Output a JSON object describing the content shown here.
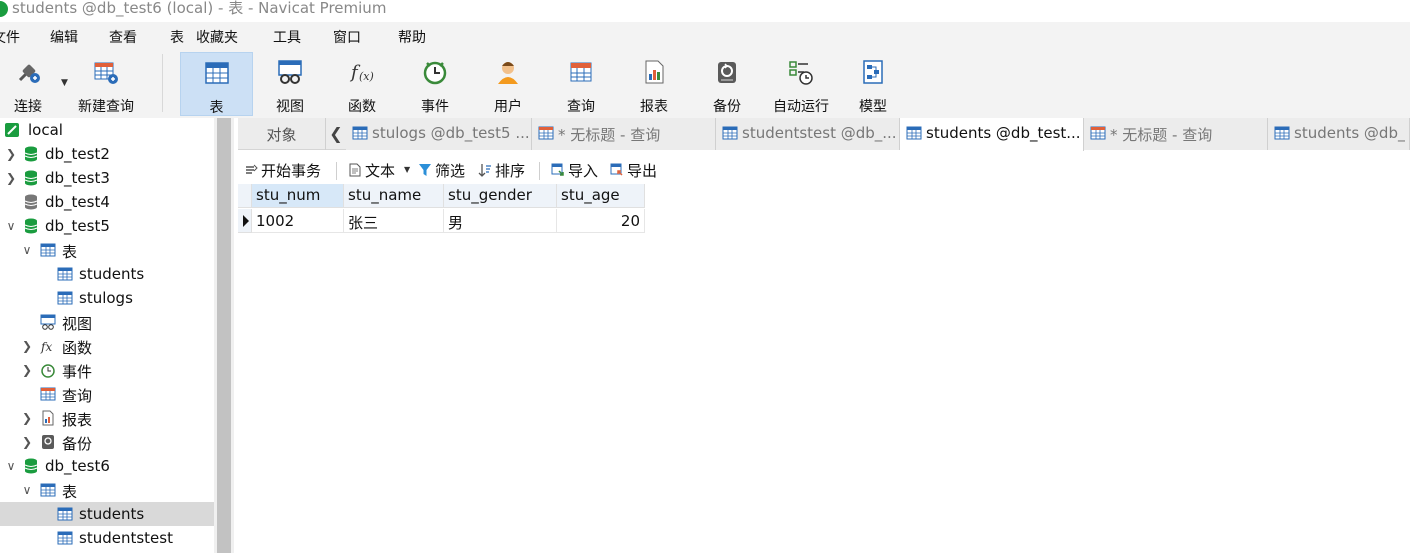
{
  "window": {
    "title": "students @db_test6 (local) - 表 - Navicat Premium"
  },
  "menu": [
    "文件",
    "编辑",
    "查看",
    "表",
    "收藏夹",
    "工具",
    "窗口",
    "帮助"
  ],
  "toolbar": [
    {
      "label": "连接",
      "icon": "plug-icon"
    },
    {
      "label": "新建查询",
      "icon": "new-query-icon"
    },
    {
      "label": "表",
      "icon": "table-icon",
      "active": true
    },
    {
      "label": "视图",
      "icon": "view-icon"
    },
    {
      "label": "函数",
      "icon": "function-icon"
    },
    {
      "label": "事件",
      "icon": "clock-icon"
    },
    {
      "label": "用户",
      "icon": "user-icon"
    },
    {
      "label": "查询",
      "icon": "query-icon"
    },
    {
      "label": "报表",
      "icon": "report-icon"
    },
    {
      "label": "备份",
      "icon": "backup-icon"
    },
    {
      "label": "自动运行",
      "icon": "schedule-icon"
    },
    {
      "label": "模型",
      "icon": "model-icon"
    }
  ],
  "sidebar": {
    "items": [
      {
        "label": "local",
        "icon": "connection-icon",
        "level": 0,
        "chevron": ""
      },
      {
        "label": "db_test2",
        "icon": "database-green-icon",
        "level": 1,
        "chevron": ">"
      },
      {
        "label": "db_test3",
        "icon": "database-green-icon",
        "level": 1,
        "chevron": ">"
      },
      {
        "label": "db_test4",
        "icon": "database-gray-icon",
        "level": 1,
        "chevron": ""
      },
      {
        "label": "db_test5",
        "icon": "database-green-icon",
        "level": 1,
        "chevron": "v"
      },
      {
        "label": "表",
        "icon": "table-icon",
        "level": 2,
        "chevron": "v"
      },
      {
        "label": "students",
        "icon": "table-icon",
        "level": 3,
        "chevron": ""
      },
      {
        "label": "stulogs",
        "icon": "table-icon",
        "level": 3,
        "chevron": ""
      },
      {
        "label": "视图",
        "icon": "view-icon",
        "level": 2,
        "chevron": ""
      },
      {
        "label": "函数",
        "icon": "function-icon",
        "level": 2,
        "chevron": ">"
      },
      {
        "label": "事件",
        "icon": "clock-icon",
        "level": 2,
        "chevron": ">"
      },
      {
        "label": "查询",
        "icon": "query-icon",
        "level": 2,
        "chevron": ""
      },
      {
        "label": "报表",
        "icon": "report-icon",
        "level": 2,
        "chevron": ">"
      },
      {
        "label": "备份",
        "icon": "backup-icon",
        "level": 2,
        "chevron": ">"
      },
      {
        "label": "db_test6",
        "icon": "database-green-icon",
        "level": 1,
        "chevron": "v"
      },
      {
        "label": "表",
        "icon": "table-icon",
        "level": 2,
        "chevron": "v"
      },
      {
        "label": "students",
        "icon": "table-icon",
        "level": 3,
        "chevron": "",
        "selected": true
      },
      {
        "label": "studentstest",
        "icon": "table-icon",
        "level": 3,
        "chevron": ""
      }
    ]
  },
  "tabs": {
    "objects_label": "对象",
    "items": [
      {
        "label": "stulogs @db_test5 ...",
        "icon": "table-icon"
      },
      {
        "label": "* 无标题 - 查询",
        "icon": "query-icon"
      },
      {
        "label": "studentstest @db_...",
        "icon": "table-icon"
      },
      {
        "label": "students @db_test...",
        "icon": "table-icon",
        "active": true
      },
      {
        "label": "* 无标题 - 查询",
        "icon": "query-icon"
      },
      {
        "label": "students @db_",
        "icon": "table-icon"
      }
    ]
  },
  "subtoolbar": {
    "begin_transaction": "开始事务",
    "text": "文本",
    "filter": "筛选",
    "sort": "排序",
    "import": "导入",
    "export": "导出"
  },
  "grid": {
    "columns": [
      "stu_num",
      "stu_name",
      "stu_gender",
      "stu_age"
    ],
    "rows": [
      [
        "1002",
        "张三",
        "男",
        "20"
      ]
    ]
  },
  "colors": {
    "accent": "#1a9c3f",
    "table_blue": "#2b6cb8",
    "active_tool": "#cce0f5"
  }
}
